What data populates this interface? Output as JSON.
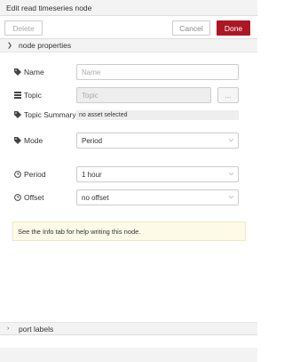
{
  "header": {
    "title": "Edit read timeseries node"
  },
  "toolbar": {
    "delete_label": "Delete",
    "cancel_label": "Cancel",
    "done_label": "Done"
  },
  "sections": {
    "node_properties": "node properties",
    "port_labels": "port labels"
  },
  "form": {
    "name": {
      "label": "Name",
      "placeholder": "Name",
      "value": ""
    },
    "topic": {
      "label": "Topic",
      "placeholder": "Topic",
      "button_label": "..."
    },
    "topic_summary": {
      "label": "Topic Summary",
      "value": "no asset selected"
    },
    "mode": {
      "label": "Mode",
      "value": "Period"
    },
    "period": {
      "label": "Period",
      "value": "1 hour"
    },
    "offset": {
      "label": "Offset",
      "value": "no offset"
    }
  },
  "tip": "See the Info tab for help writing this node.",
  "colors": {
    "accent": "#ad1625",
    "tip_bg": "#fdfbe8",
    "panel_bg": "#f3f3f3"
  },
  "icons": [
    "tag-icon",
    "list-icon",
    "clock-icon",
    "chevron-down-icon",
    "chevron-right-icon"
  ]
}
